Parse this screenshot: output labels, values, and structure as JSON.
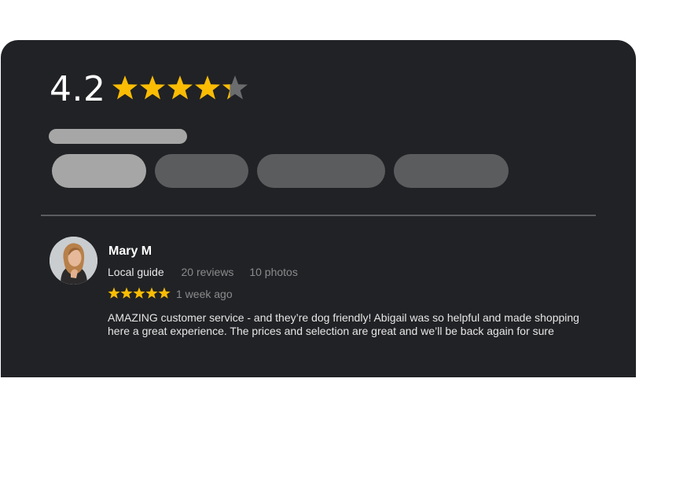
{
  "rating": {
    "value": "4.2",
    "stars": 4.2,
    "star_color": "#fbbc04",
    "empty_star_color": "#6b6c6e"
  },
  "filter_placeholders": {
    "title_bar_color": "#a6a6a6",
    "chips": [
      {
        "color": "#a6a6a6",
        "selected": true
      },
      {
        "color": "#5b5c5e",
        "selected": false
      },
      {
        "color": "#5b5c5e",
        "selected": false
      },
      {
        "color": "#5b5c5e",
        "selected": false
      }
    ]
  },
  "review": {
    "author": "Mary M",
    "badge": "Local guide",
    "reviews_count": "20 reviews",
    "photos_count": "10 photos",
    "stars": 5,
    "time_ago": "1 week ago",
    "text": "AMAZING customer service - and they’re dog friendly! Abigail was so helpful and made shopping here a great experience. The prices and selection are great and we’ll be back again for sure"
  },
  "colors": {
    "card_background": "#212225",
    "divider": "#5b5c5e"
  }
}
